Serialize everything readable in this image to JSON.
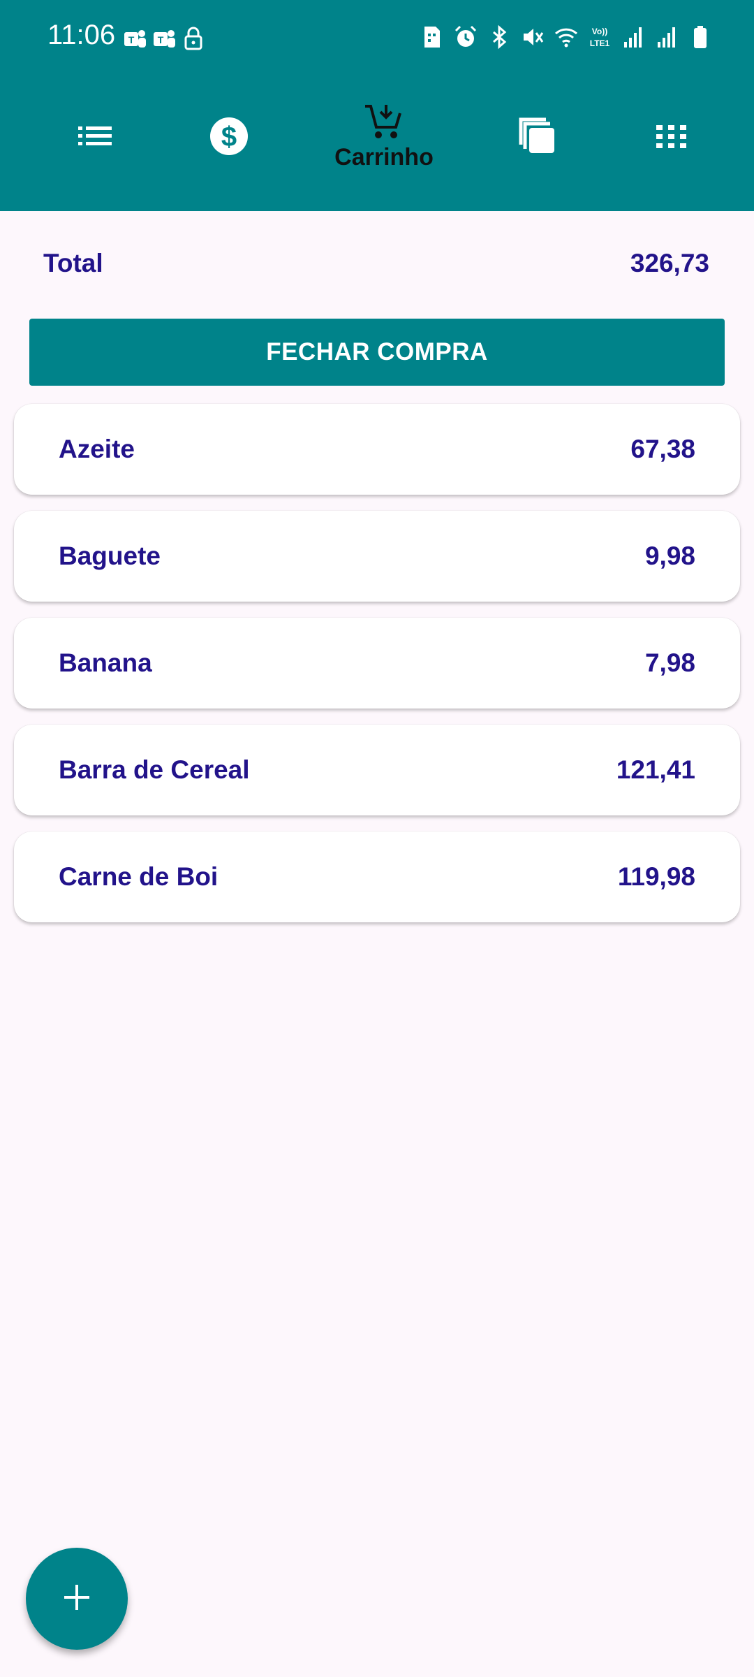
{
  "status_bar": {
    "time": "11:06",
    "left_icons": [
      "teams-icon",
      "teams-icon",
      "lock-icon"
    ],
    "right_icons": [
      "sim-icon",
      "alarm-icon",
      "bluetooth-icon",
      "mute-icon",
      "wifi-icon",
      "volte-icon",
      "signal-icon",
      "signal-icon",
      "battery-icon"
    ]
  },
  "nav": {
    "tabs": [
      {
        "icon": "list-icon",
        "label": ""
      },
      {
        "icon": "dollar-icon",
        "label": ""
      },
      {
        "icon": "cart-add-icon",
        "label": "Carrinho"
      },
      {
        "icon": "copy-icon",
        "label": ""
      },
      {
        "icon": "grid-icon",
        "label": ""
      }
    ],
    "active_tab": "Carrinho"
  },
  "summary": {
    "total_label": "Total",
    "total_value": "326,73"
  },
  "checkout_button": "FECHAR COMPRA",
  "items": [
    {
      "name": "Azeite",
      "price": "67,38"
    },
    {
      "name": "Baguete",
      "price": "9,98"
    },
    {
      "name": "Banana",
      "price": "7,98"
    },
    {
      "name": "Barra de Cereal",
      "price": "121,41"
    },
    {
      "name": "Carne de Boi",
      "price": "119,98"
    }
  ],
  "fab": {
    "icon": "plus-icon"
  },
  "colors": {
    "primary": "#00838a",
    "text": "#22138a",
    "background": "#fdf7fc"
  }
}
